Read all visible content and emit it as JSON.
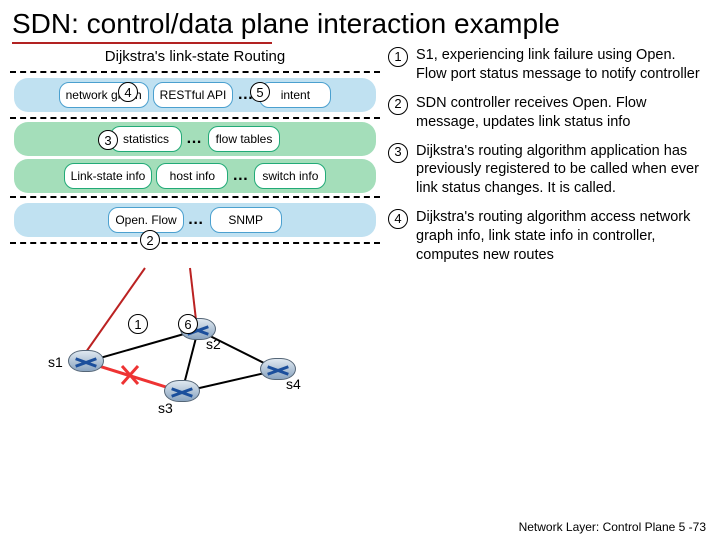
{
  "title": "SDN: control/data plane interaction example",
  "controller_title": "Dijkstra's link-state Routing",
  "layers": {
    "top": {
      "cells": [
        "network graph",
        "RESTful API",
        "intent"
      ],
      "dots": "…"
    },
    "mid": {
      "cells": [
        "statistics",
        "flow tables"
      ],
      "dots": "…",
      "row2": [
        "Link-state info",
        "host info",
        "switch info"
      ],
      "dots2": "…"
    },
    "bot": {
      "cells": [
        "Open. Flow",
        "SNMP"
      ],
      "dots": "…"
    }
  },
  "circles": {
    "c1": "1",
    "c2": "2",
    "c3": "3",
    "c4": "4",
    "c5": "5",
    "c6": "6"
  },
  "switches": {
    "s1": "s1",
    "s2": "s2",
    "s3": "s3",
    "s4": "s4"
  },
  "steps": [
    {
      "n": "1",
      "text": "S1, experiencing link failure using Open. Flow port status message to notify controller"
    },
    {
      "n": "2",
      "text": "SDN controller receives Open. Flow message, updates link status info"
    },
    {
      "n": "3",
      "text": "Dijkstra's routing algorithm application has previously registered to be called when ever link status changes.  It is called."
    },
    {
      "n": "4",
      "text": "Dijkstra's routing algorithm access network graph info, link state info in controller, computes new routes"
    }
  ],
  "footer": "Network Layer: Control Plane  5 -73"
}
